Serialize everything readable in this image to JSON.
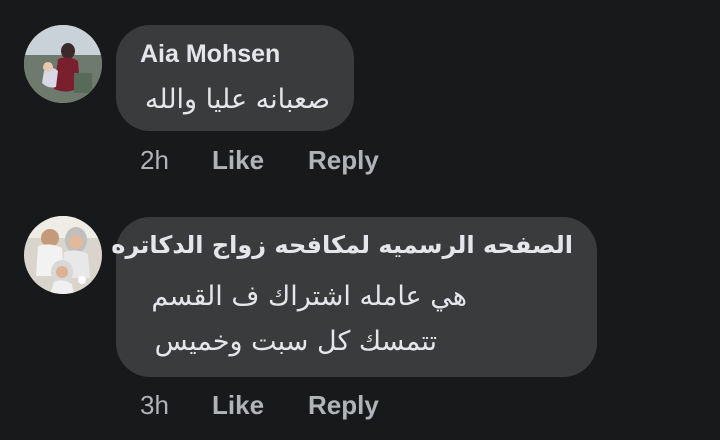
{
  "comments": [
    {
      "author": "Aia Mohsen",
      "lines": [
        "صعبانه عليا والله"
      ],
      "time": "2h",
      "like_label": "Like",
      "reply_label": "Reply"
    },
    {
      "author": "الصفحه الرسميه لمكافحه زواج الدكاتره",
      "lines": [
        "هي عامله اشتراك ف القسم",
        "تتمسك كل سبت وخميس"
      ],
      "time": "3h",
      "like_label": "Like",
      "reply_label": "Reply"
    }
  ],
  "colors": {
    "background": "#18191a",
    "bubble": "#3a3b3c",
    "text": "#e4e6eb",
    "secondary_text": "#b0b3b8"
  }
}
